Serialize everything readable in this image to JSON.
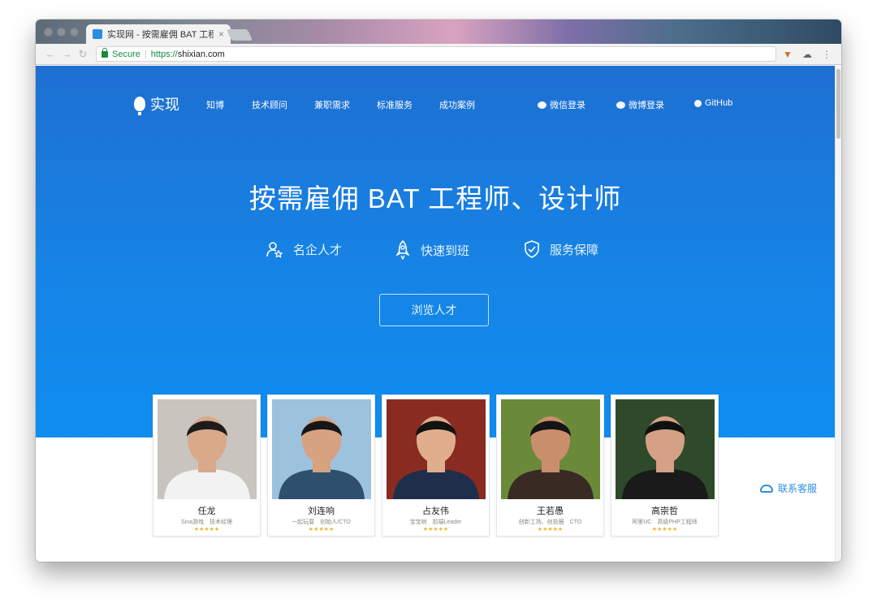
{
  "browser": {
    "tab_title": "实现网 - 按需雇佣 BAT 工程师",
    "tab_close": "×",
    "back_icon": "arrow-left",
    "forward_icon": "arrow-right",
    "reload_icon": "reload",
    "secure_label": "Secure",
    "url_scheme": "https://",
    "url_host": "shixian.com",
    "extensions": [
      "fox-icon",
      "cloud-icon"
    ]
  },
  "nav": {
    "logo_text": "实现",
    "links": [
      "知博",
      "技术顾问",
      "兼职需求",
      "标准服务",
      "成功案例"
    ],
    "wechat_login": "微信登录",
    "weibo_login": "微博登录",
    "github": "GitHub"
  },
  "hero": {
    "headline": "按需雇佣 BAT 工程师、设计师",
    "features": [
      {
        "label": "名企人才",
        "icon": "user-star-icon"
      },
      {
        "label": "快速到班",
        "icon": "rocket-icon"
      },
      {
        "label": "服务保障",
        "icon": "shield-check-icon"
      }
    ],
    "cta": "浏览人才"
  },
  "talents": [
    {
      "name": "任龙",
      "role": "Sina游戏　技术经理",
      "stars": "★★★★★",
      "shirt": "#f2f2f2",
      "bg": "#c9c4bd",
      "skin": "#d9a98a",
      "hair": "#1c1c1c"
    },
    {
      "name": "刘连响",
      "role": "一起玩耍　创始人/CTO",
      "stars": "★★★★★",
      "shirt": "#2f4f6f",
      "bg": "#9cc2de",
      "skin": "#d7a27f",
      "hair": "#161616"
    },
    {
      "name": "占友伟",
      "role": "宝宝树　前端Leader",
      "stars": "★★★★★",
      "shirt": "#1f2e4a",
      "bg": "#8a2b22",
      "skin": "#e0ae8c",
      "hair": "#121212"
    },
    {
      "name": "王若愚",
      "role": "创新工场、创投圈　CTO",
      "stars": "★★★★★",
      "shirt": "#3a2a24",
      "bg": "#6a8a3a",
      "skin": "#c98f6c",
      "hair": "#151515"
    },
    {
      "name": "高崇哲",
      "role": "阿里UC　高级PHP工程师",
      "stars": "★★★★★",
      "shirt": "#1a1a1a",
      "bg": "#2e4a2a",
      "skin": "#d4a184",
      "hair": "#101010"
    }
  ],
  "support": {
    "label": "联系客服"
  }
}
